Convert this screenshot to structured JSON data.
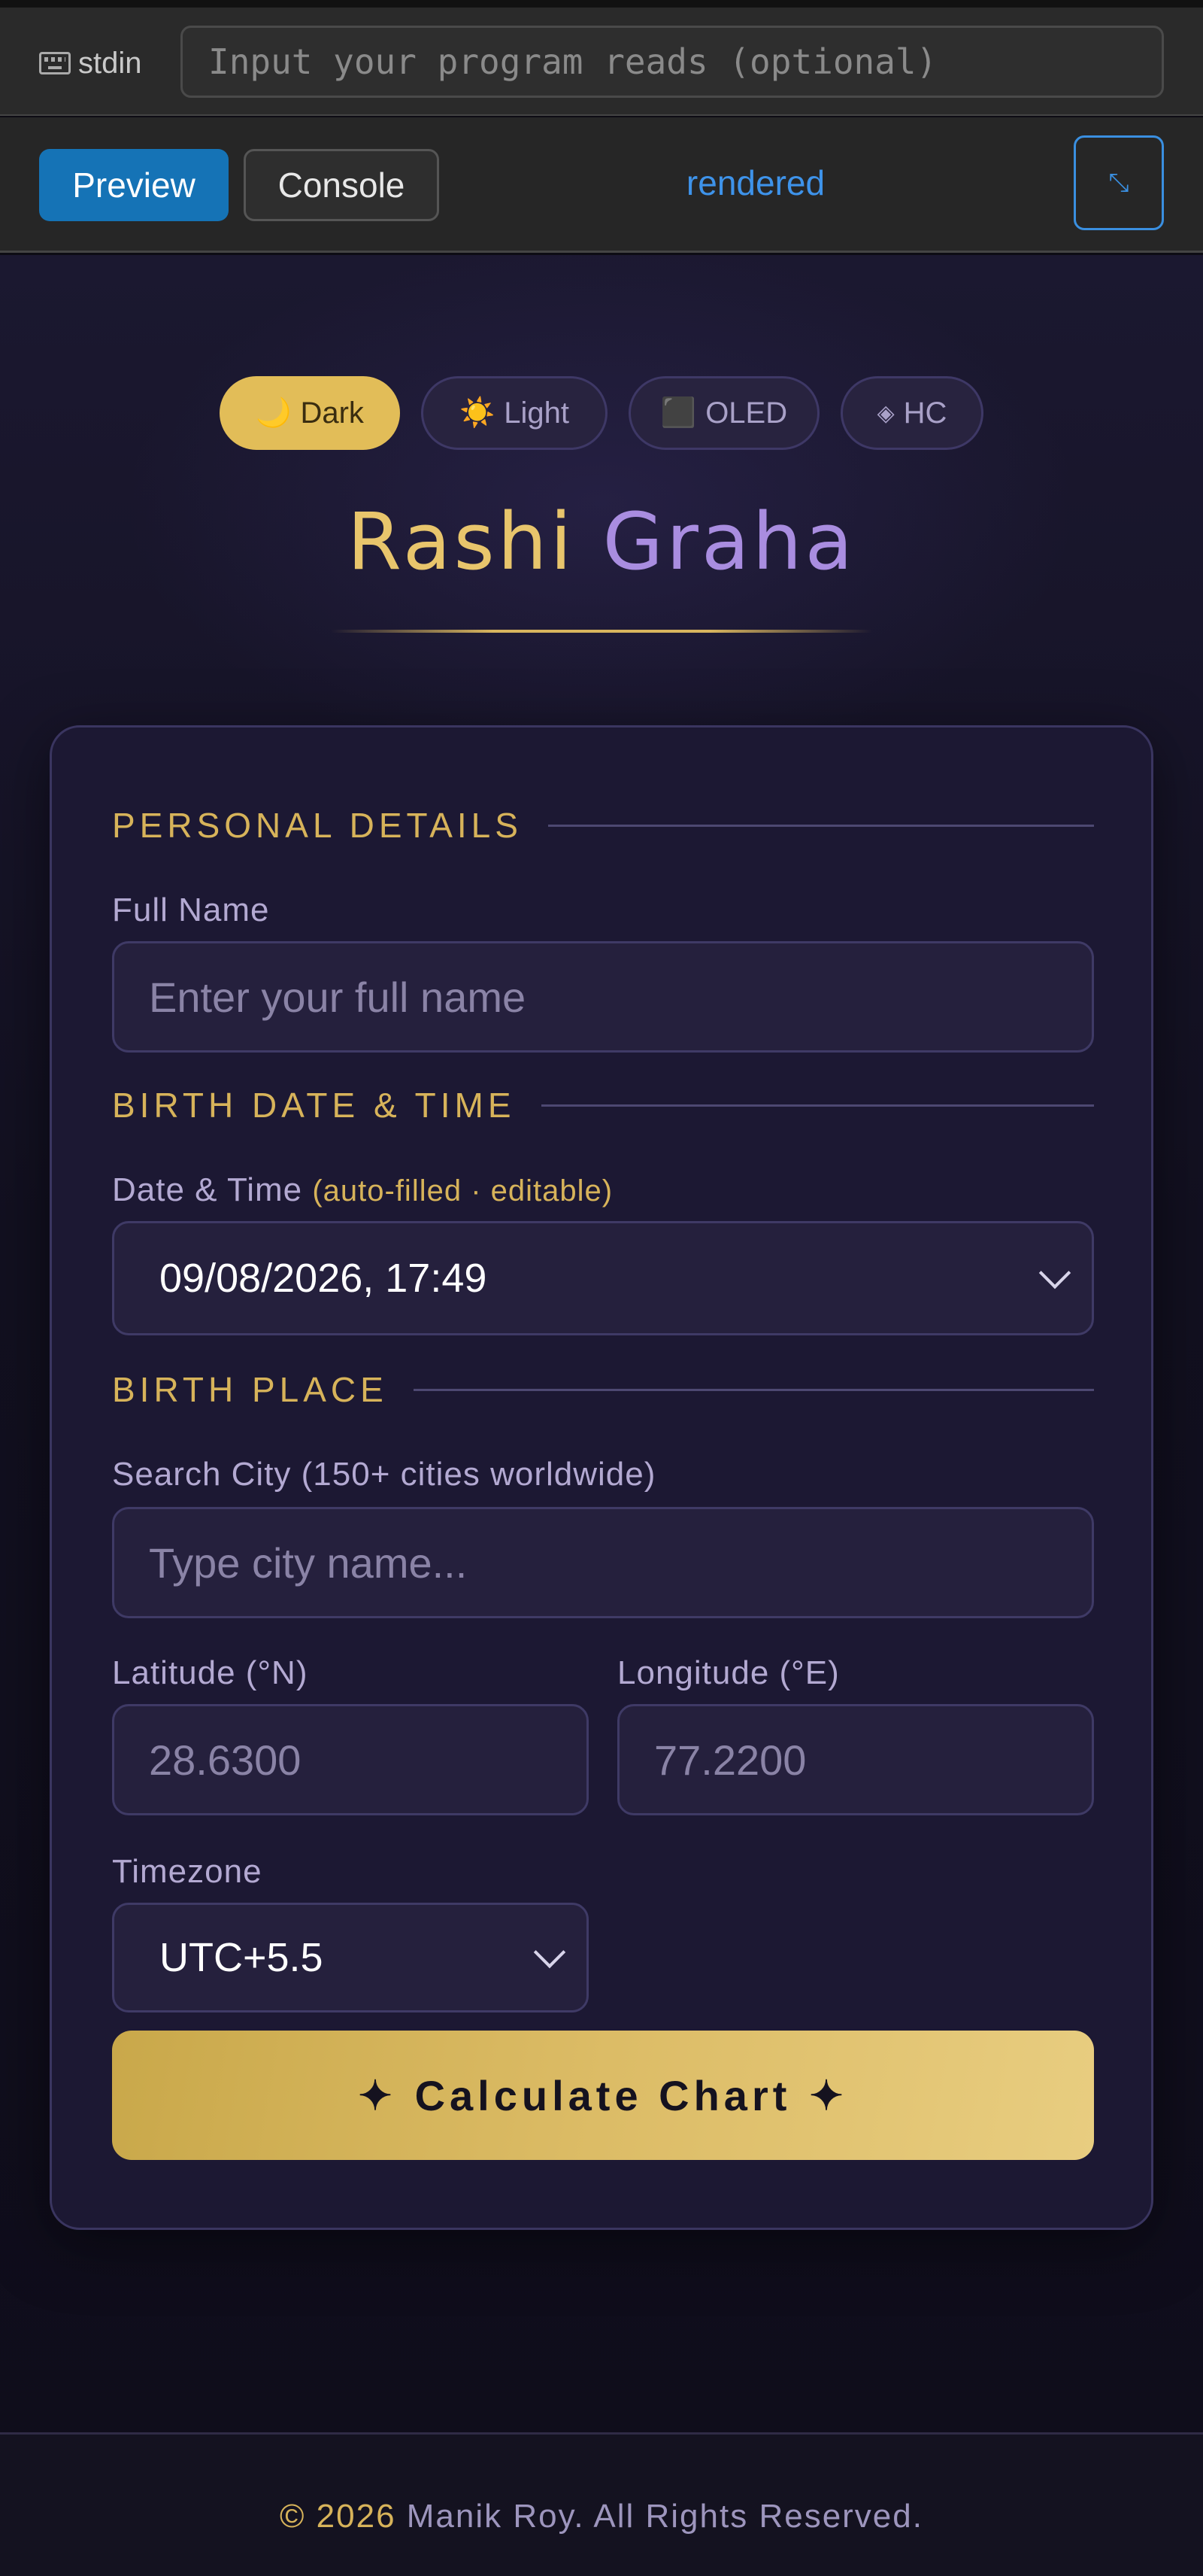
{
  "stdin": {
    "label": "stdin",
    "placeholder": "Input your program reads (optional)"
  },
  "toolbar": {
    "preview_label": "Preview",
    "console_label": "Console",
    "status": "rendered",
    "expand_icon": "⤡"
  },
  "themes": [
    {
      "icon": "🌙",
      "label": "Dark",
      "active": true
    },
    {
      "icon": "☀️",
      "label": "Light",
      "active": false
    },
    {
      "icon": "⬛",
      "label": "OLED",
      "active": false
    },
    {
      "icon": "◈",
      "label": "HC",
      "active": false
    }
  ],
  "title": {
    "part1": "Rashi",
    "part2": "Graha"
  },
  "sections": {
    "personal": "PERSONAL DETAILS",
    "birth_datetime": "BIRTH DATE & TIME",
    "birth_place": "BIRTH PLACE"
  },
  "fields": {
    "full_name_label": "Full Name",
    "full_name_placeholder": "Enter your full name",
    "datetime_label": "Date & Time",
    "datetime_hint": "(auto-filled · editable)",
    "datetime_value": "09/08/2026, 17:49",
    "city_label": "Search City (150+ cities worldwide)",
    "city_placeholder": "Type city name...",
    "latitude_label": "Latitude (°N)",
    "latitude_placeholder": "28.6300",
    "longitude_label": "Longitude (°E)",
    "longitude_placeholder": "77.2200",
    "timezone_label": "Timezone",
    "timezone_value": "UTC+5.5"
  },
  "calculate": {
    "star": "✦",
    "label": "Calculate Chart"
  },
  "footer": {
    "copy": "©",
    "year": "2026",
    "text": "Manik Roy. All Rights Reserved."
  },
  "colors": {
    "accent_gold": "#d7b35a",
    "accent_purple": "#a98de0",
    "preview_blue": "#1573b6"
  }
}
